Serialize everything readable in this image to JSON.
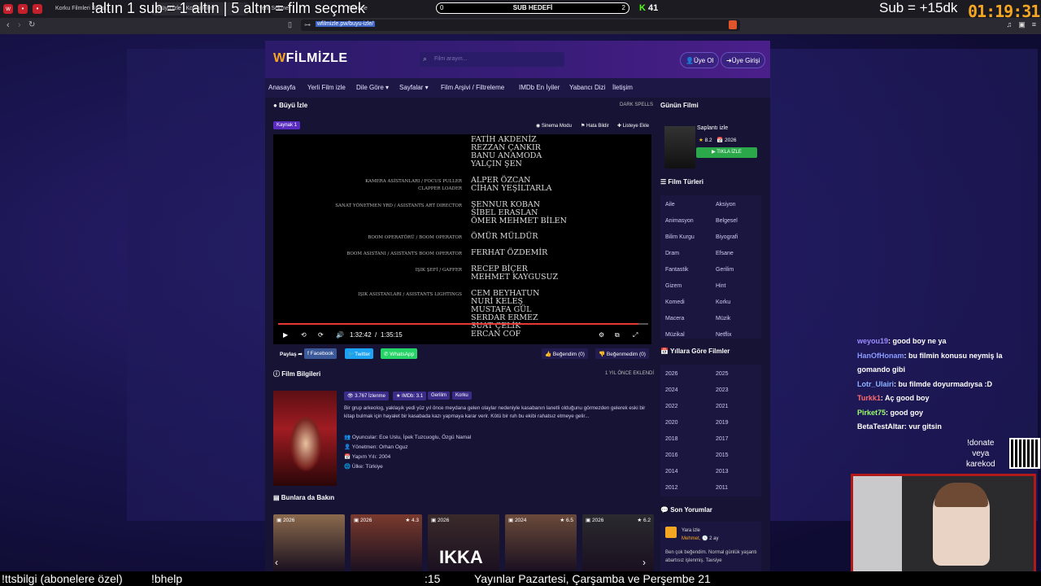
{
  "browser": {
    "tabs": [
      "Korku Filmleri Serisi...",
      "Büyü İzle | Korku Filmi",
      "Yeni Sekme",
      "Filmizle"
    ],
    "url": "wfilmizle.pw/buyu-izle/"
  },
  "overlay": {
    "top_left": "!altın    1 sub = 1 altın | 5 altın = film seçmek",
    "sub_goal_label": "SUB HEDEFİ",
    "sub_goal_current": "0",
    "sub_goal_target": "2",
    "kick_count": "41",
    "sub_timer": "Sub = +15dk",
    "timer": "01:19:31",
    "donate": "!donate\nveya\nkarekod",
    "bottom": [
      "!ttsbilgi (abonelere özel)",
      "!bhelp",
      ":15",
      "Yayınlar Pazartesi, Çarşamba ve Perşembe 21"
    ]
  },
  "chat": [
    {
      "user": "weyou19",
      "text": ": good boy ne ya",
      "color": "#9b8cff"
    },
    {
      "user": "HanOfHonam",
      "text": ": bu filmin konusu neymiş la",
      "color": "#8c9bff"
    },
    {
      "user": "",
      "text": "gomando gibi",
      "color": "#ffffff"
    },
    {
      "user": "Lotr_Ulairi",
      "text": ": bu filmde doyurmadıysa :D",
      "color": "#8cb4ff"
    },
    {
      "user": "Turkk1",
      "text": ": Aç good boy",
      "color": "#ff6b6b"
    },
    {
      "user": "Pirket75",
      "text": ": good goy",
      "color": "#9cff6b"
    },
    {
      "user": "BetaTestAltar",
      "text": ": vur gitsin",
      "color": "#ffffff"
    }
  ],
  "site": {
    "logo_prefix": "W",
    "logo_text": "FİLMİZLE",
    "search_placeholder": "Film arayın...",
    "signup": "Üye Ol",
    "login": "Üye Girişi",
    "menu": [
      "Anasayfa",
      "Yerli Film izle",
      "Dile Göre ▾",
      "Sayfalar ▾",
      "Film Arşivi / Filtreleme",
      "IMDb En İyiler",
      "Yabancı Dizi",
      "İletişim"
    ],
    "player_title": "Büyü İzle",
    "player_sub": "DARK SPELLS",
    "source": "Kaynak 1",
    "cinema_mode": "Sinema Modu",
    "report": "Hata Bildir",
    "add_list": "Listeye Ekle",
    "credits": [
      {
        "role": "",
        "names": [
          "FATİH AKDENİZ",
          "REZZAN ÇANKIR",
          "BANU ANAMODA",
          "YALÇIN ŞEN"
        ]
      },
      {
        "role": "KAMERA ASİSTANLARI / FOCUS PULLER\nCLAPPER LOADER",
        "names": [
          "ALPER ÖZCAN",
          "CİHAN YEŞİLTARLA"
        ]
      },
      {
        "role": "SANAT YÖNETMEN YRD / ASISTANTS ART DIRECTOR",
        "names": [
          "ŞENNUR KOBAN",
          "SİBEL ERASLAN",
          "ÖMER MEHMET BİLEN"
        ]
      },
      {
        "role": "BOOM OPERATÖRÜ / BOOM OPERATOR",
        "names": [
          "ÖMÜR MÜLDÜR"
        ]
      },
      {
        "role": "BOOM ASISTANI / ASISTANTS BOOM OPERATOR",
        "names": [
          "FERHAT ÖZDEMİR"
        ]
      },
      {
        "role": "IŞIK ŞEFİ / GAFFER",
        "names": [
          "RECEP BİÇER",
          "MEHMET KAYGUSUZ"
        ]
      },
      {
        "role": "IŞIK ASISTANLARI / ASISTANTS LIGHTINGS",
        "names": [
          "CEM BEYHATUN",
          "NURİ KELEŞ",
          "MUSTAFA GÜL",
          "SERDAR ERMEZ",
          "SUAT ÇELİK",
          "ERCAN COF"
        ]
      }
    ],
    "time_current": "1:32:42",
    "time_total": "1:35:15",
    "progress": 0.973,
    "share_label": "Paylaş",
    "facebook": "Facebook",
    "twitter": "Twitter",
    "whatsapp": "WhatsApp",
    "like": "Beğendim (0)",
    "dislike": "Beğenmedim (0)",
    "info_title": "Film Bilgileri",
    "added": "1 YIL ÖNCE EKLENDİ",
    "views": "3.767 İzlenme",
    "imdb": "IMDb: 3.1",
    "genre1": "Gerilim",
    "genre2": "Korku",
    "description": "Bir grup arkeolog, yaklaşık yedi yüz yıl önce meydana gelen olaylar nedeniyle kasabanın lanetli olduğunu görmezden gelerek eski bir kitap bulmak için hayalet bir kasabada kazı yapmaya karar verir. Kötü bir ruh bu ekibi rahatsız etmeye gelir...",
    "actors_label": "Oyuncular:",
    "actors": "Ece Uslu, İpek Tuzcuoglu, Özgü Namal",
    "director_label": "Yönetmen:",
    "director": "Orhan Oguz",
    "year_label": "Yapım Yılı:",
    "year": "2004",
    "country_label": "Ülke:",
    "country": "Türkiye",
    "also_title": "Bunlara da Bakın",
    "thumbs": [
      {
        "year": "2026",
        "rating": "",
        "color": "#8b6a4d"
      },
      {
        "year": "2026",
        "rating": "4.3",
        "color": "#7a3a2d"
      },
      {
        "year": "2026",
        "rating": "",
        "color": "#3a2a2a"
      },
      {
        "year": "2024",
        "rating": "6.5",
        "color": "#6a4a3a"
      },
      {
        "year": "2026",
        "rating": "6.2",
        "color": "#2a2a2f"
      }
    ],
    "thumb_label": "IKKA",
    "day_title": "Günün Filmi",
    "day_film": "Saplantı izle",
    "day_rating": "8.2",
    "day_year": "2026",
    "day_btn": "TIKLA İZLE",
    "genres_title": "Film Türleri",
    "genres": [
      "Aile",
      "Aksiyon",
      "Animasyon",
      "Belgesel",
      "Bilim Kurgu",
      "Biyografi",
      "Dram",
      "Efsane",
      "Fantastik",
      "Gerilim",
      "Gizem",
      "Hint",
      "Komedi",
      "Korku",
      "Macera",
      "Müzik",
      "Müzikal",
      "Netflix"
    ],
    "years_title": "Yıllara Göre Filmler",
    "years": [
      "2026",
      "2025",
      "2024",
      "2023",
      "2022",
      "2021",
      "2020",
      "2019",
      "2018",
      "2017",
      "2016",
      "2015",
      "2014",
      "2013",
      "2012",
      "2011"
    ],
    "comments_title": "Son Yorumlar",
    "comment_film": "Yara izle",
    "comment_user": "Mehmet,",
    "comment_time": "2 ay",
    "comment_text": "Ben çok beğendim. Normal günlük yaşantı abartısız işlenmiş. Tavsiye"
  },
  "colors": {
    "accent": "#6a2fd1",
    "green": "#2aa84a",
    "kick": "#53fc18",
    "timer": "#f5a623"
  }
}
